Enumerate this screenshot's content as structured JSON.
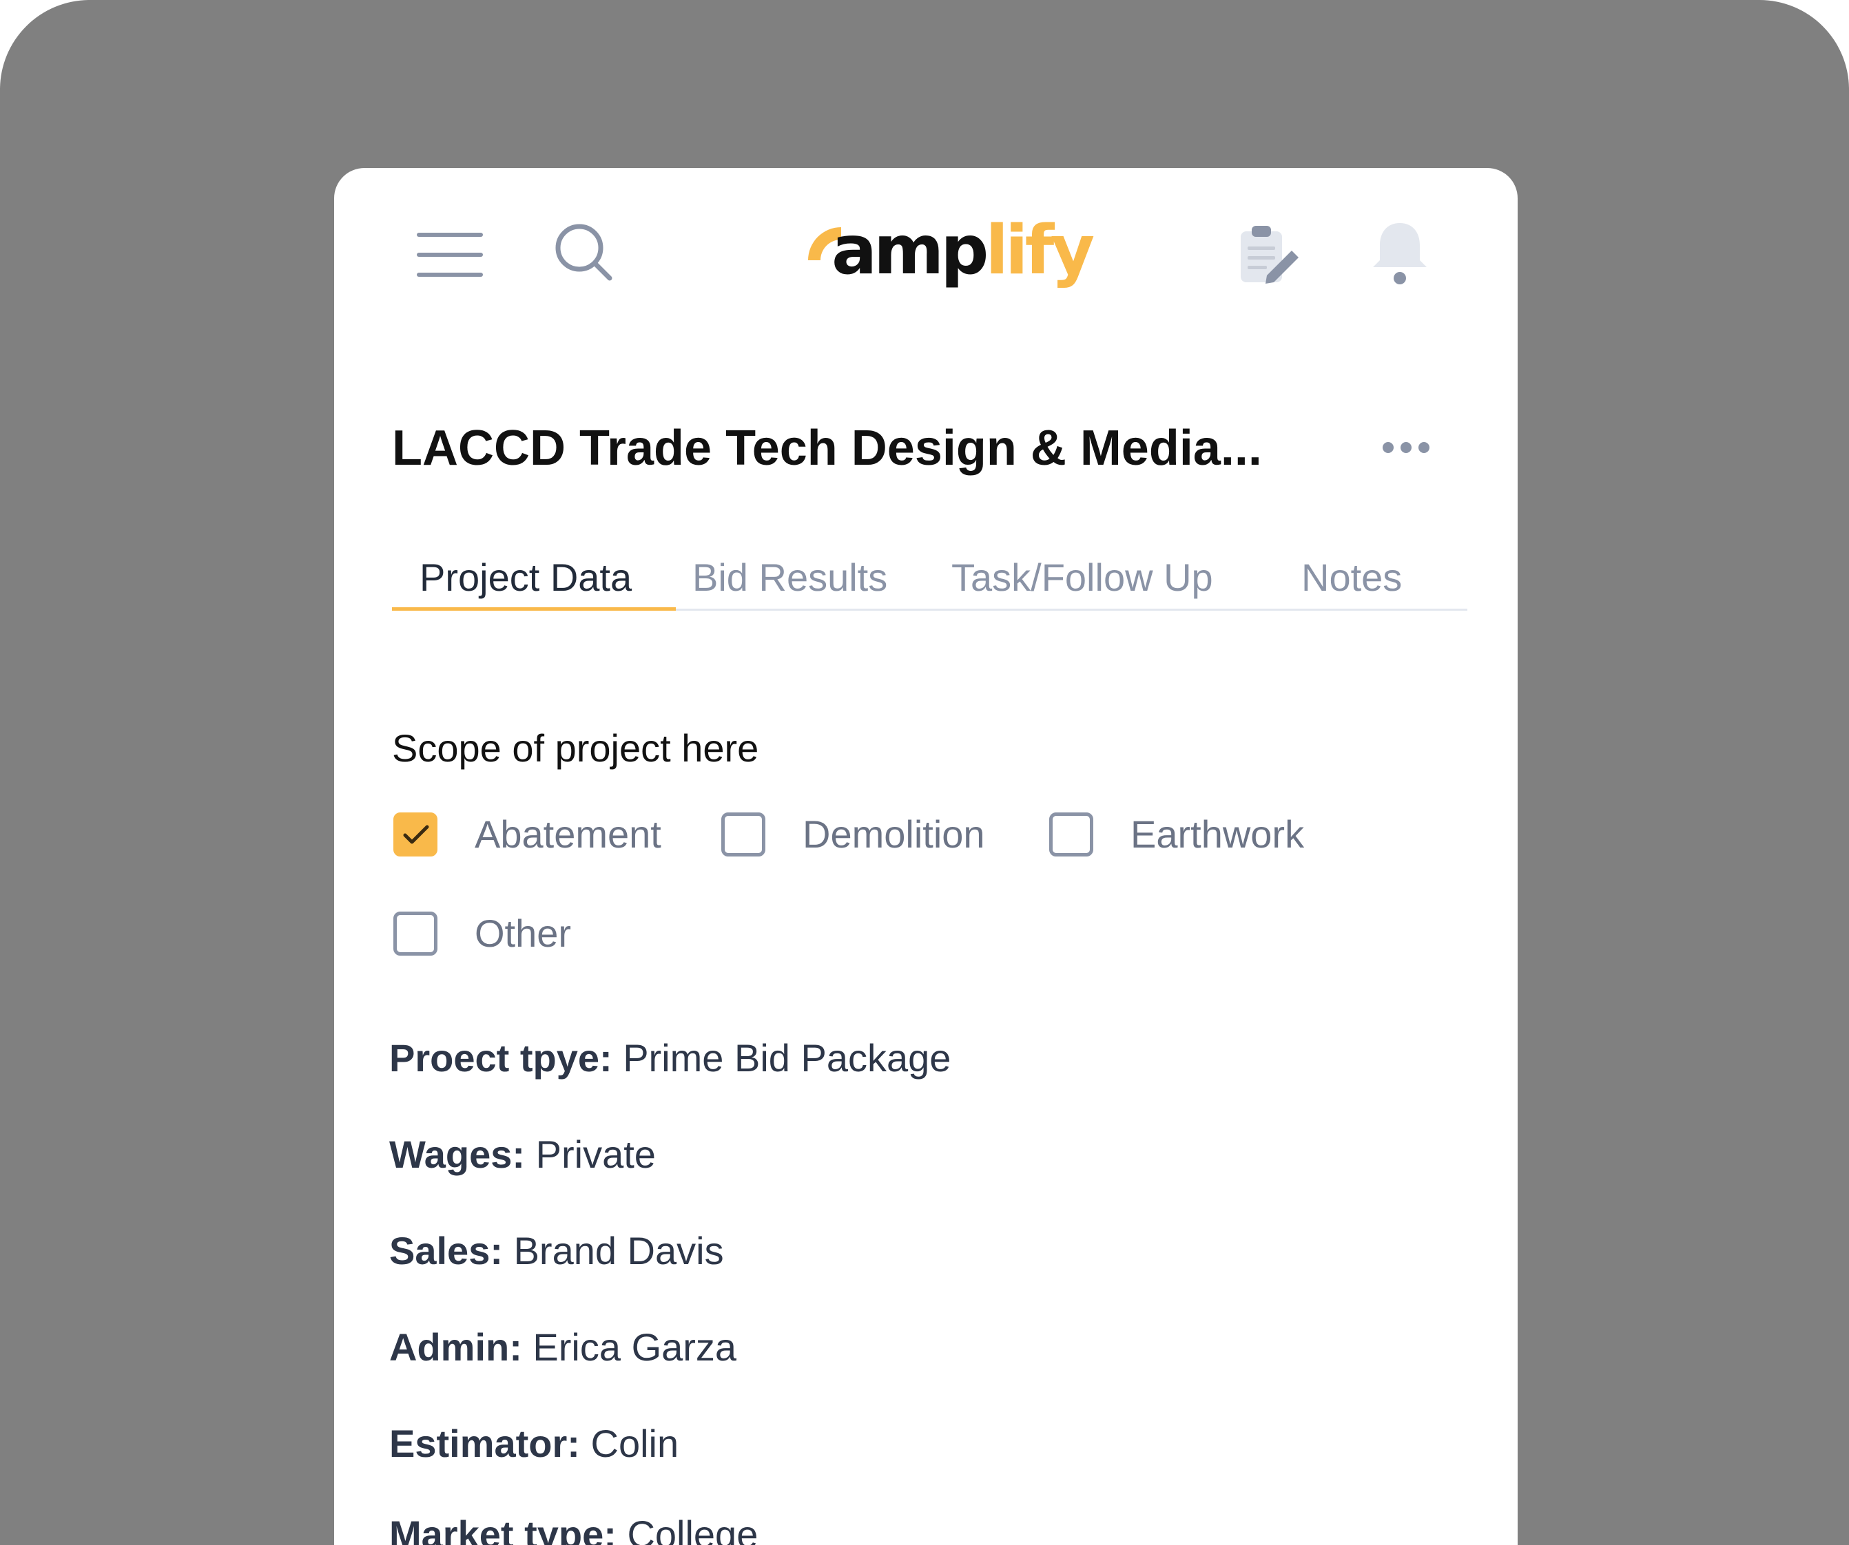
{
  "app": {
    "logo_text_part1": "amp",
    "logo_text_part2": "lify",
    "brand_color": "#f9b94a"
  },
  "header": {
    "icons": [
      "menu-icon",
      "search-icon",
      "clipboard-edit-icon",
      "bell-icon"
    ]
  },
  "project": {
    "title": "LACCD Trade Tech Design & Media...",
    "more_icon": "ellipsis-icon"
  },
  "tabs": [
    {
      "label": "Project Data",
      "active": true
    },
    {
      "label": "Bid Results",
      "active": false
    },
    {
      "label": "Task/Follow Up",
      "active": false
    },
    {
      "label": "Notes",
      "active": false
    }
  ],
  "scope": {
    "label": "Scope of project here",
    "options": [
      {
        "label": "Abatement",
        "checked": true
      },
      {
        "label": "Demolition",
        "checked": false
      },
      {
        "label": "Earthwork",
        "checked": false
      },
      {
        "label": "Other",
        "checked": false
      }
    ]
  },
  "details": [
    {
      "label": "Proect tpye:",
      "value": "Prime Bid Package"
    },
    {
      "label": "Wages:",
      "value": "Private"
    },
    {
      "label": "Sales:",
      "value": "Brand Davis"
    },
    {
      "label": "Admin:",
      "value": "Erica Garza"
    },
    {
      "label": "Estimator:",
      "value": "Colin"
    },
    {
      "label": "Market type:",
      "value": "College"
    }
  ]
}
